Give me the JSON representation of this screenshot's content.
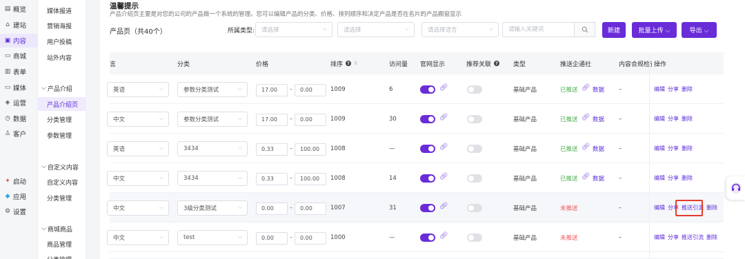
{
  "sidebar1": {
    "items": [
      {
        "icon": "overview-icon",
        "glyph": "▤",
        "label": "概览"
      },
      {
        "icon": "build-icon",
        "glyph": "⌂",
        "label": "建站"
      },
      {
        "icon": "content-icon",
        "glyph": "▣",
        "label": "内容",
        "active": true
      },
      {
        "icon": "shop-icon",
        "glyph": "▭",
        "label": "商城"
      },
      {
        "icon": "form-icon",
        "glyph": "▥",
        "label": "表单"
      },
      {
        "icon": "media-icon",
        "glyph": "▭",
        "label": "媒体"
      },
      {
        "icon": "operation-icon",
        "glyph": "◈",
        "label": "运营"
      },
      {
        "icon": "data-icon",
        "glyph": "◷",
        "label": "数据"
      },
      {
        "icon": "customer-icon",
        "glyph": "♙",
        "label": "客户"
      },
      {
        "icon": "launch-icon",
        "glyph": "✦",
        "label": "启动"
      },
      {
        "icon": "app-icon",
        "glyph": "◆",
        "label": "应用"
      },
      {
        "icon": "settings-icon",
        "glyph": "⚙",
        "label": "设置"
      }
    ]
  },
  "sidebar2": {
    "items": [
      "媒体报道",
      "营销海报",
      "用户投稿",
      "站外内容"
    ],
    "group_product": "产品介绍",
    "product_items": [
      "产品介绍页",
      "分类管理",
      "参数管理"
    ],
    "group_custom": "自定义内容",
    "custom_items": [
      "自定义内容",
      "分类管理"
    ],
    "group_mall": "商城商品",
    "mall_items": [
      "商品管理",
      "分类管理"
    ]
  },
  "tip": {
    "title": "温馨提示",
    "text": "产品介绍页主要是对您的公司的产品做一个系统的管理。您可以编辑产品的分类、价格、排列顺序和决定产品是否在名片的产品橱窗显示"
  },
  "toolbar": {
    "page_title": "产品页（共40个）",
    "filter_label": "所属类型:",
    "select1_placeholder": "请选择",
    "select2_placeholder": "请选择",
    "select3_placeholder": "请选择语言",
    "search_placeholder": "请输入关键词",
    "new_label": "新建",
    "batch_upload_label": "批量上传 ⌵",
    "export_label": "导出 ⌵"
  },
  "table": {
    "headers": {
      "lang": "言",
      "category": "分类",
      "price": "价格",
      "sort": "排序",
      "visits": "访问量",
      "site_show": "官网显示",
      "recommend": "推荐关联",
      "type": "类型",
      "push": "推送企通社",
      "compliance": "内容合规检查",
      "actions": "操作"
    },
    "rows": [
      {
        "lang": "英语",
        "category": "参数分类测试",
        "price_min": "17.00",
        "price_max": "0.00",
        "sort": "1009",
        "visits": "6",
        "site_on": true,
        "rec_on": false,
        "type": "基础产品",
        "push": "已推送",
        "pushed": true,
        "data": "数据",
        "compliance": "–",
        "a1": "编辑",
        "a2": "分享",
        "a3": "删除"
      },
      {
        "lang": "中文",
        "category": "参数分类测试",
        "price_min": "17.00",
        "price_max": "0.00",
        "sort": "1009",
        "visits": "30",
        "site_on": true,
        "rec_on": false,
        "type": "基础产品",
        "push": "已推送",
        "pushed": true,
        "data": "数据",
        "compliance": "–",
        "a1": "编辑",
        "a2": "分享",
        "a3": "删除"
      },
      {
        "lang": "英语",
        "category": "3434",
        "price_min": "0.33",
        "price_max": "100.00",
        "sort": "1008",
        "visits": "—",
        "site_on": true,
        "rec_on": false,
        "type": "基础产品",
        "push": "已推送",
        "pushed": true,
        "data": "数据",
        "compliance": "–",
        "a1": "编辑",
        "a2": "分享",
        "a3": "删除"
      },
      {
        "lang": "中文",
        "category": "3434",
        "price_min": "0.33",
        "price_max": "100.00",
        "sort": "1008",
        "visits": "14",
        "site_on": true,
        "rec_on": false,
        "type": "基础产品",
        "push": "已推送",
        "pushed": true,
        "data": "数据",
        "compliance": "–",
        "a1": "编辑",
        "a2": "分享",
        "a3": "删除"
      },
      {
        "lang": "中文",
        "category": "3级分类测试",
        "price_min": "0.00",
        "price_max": "0.00",
        "sort": "1007",
        "visits": "31",
        "site_on": true,
        "rec_on": false,
        "type": "基础产品",
        "push": "未推送",
        "pushed": false,
        "data": "",
        "compliance": "–",
        "a1": "编辑",
        "a2": "分享",
        "a_push": "推送引流",
        "a3": "删除"
      },
      {
        "lang": "中文",
        "category": "test",
        "price_min": "0.00",
        "price_max": "0.00",
        "sort": "1000",
        "visits": "—",
        "site_on": true,
        "rec_on": false,
        "type": "基础产品",
        "push": "未推送",
        "pushed": false,
        "data": "",
        "compliance": "–",
        "a1": "编辑",
        "a2": "分享",
        "a_push": "推送引流",
        "a3": "删除"
      }
    ]
  },
  "colors": {
    "accent": "#6a2cd8",
    "pushed": "#4caf50",
    "not_pushed": "#f05a5a",
    "highlight": "#e63a2e"
  }
}
